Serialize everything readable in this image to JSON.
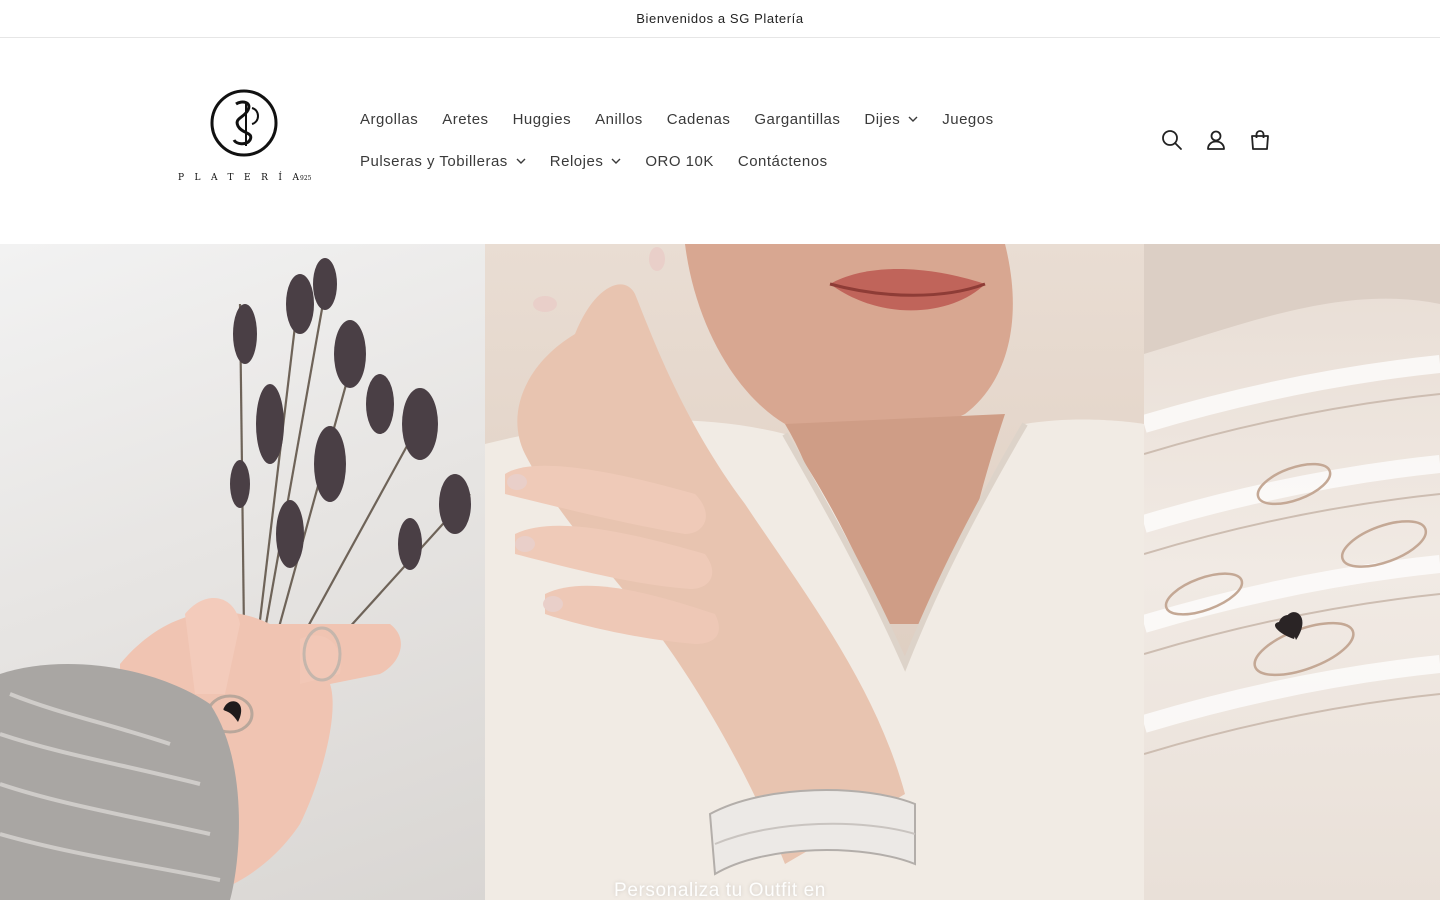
{
  "announcement": {
    "text": "Bienvenidos a SG Platería"
  },
  "logo": {
    "monogram": "SG",
    "wordmark": "PLATERÍA",
    "mark": "925"
  },
  "nav": {
    "row1": [
      {
        "label": "Argollas",
        "dropdown": false
      },
      {
        "label": "Aretes",
        "dropdown": false
      },
      {
        "label": "Huggies",
        "dropdown": false
      },
      {
        "label": "Anillos",
        "dropdown": false
      },
      {
        "label": "Cadenas",
        "dropdown": false
      },
      {
        "label": "Gargantillas",
        "dropdown": false
      },
      {
        "label": "Dijes",
        "dropdown": true
      },
      {
        "label": "Juegos",
        "dropdown": false
      }
    ],
    "row2": [
      {
        "label": "Pulseras y Tobilleras",
        "dropdown": true
      },
      {
        "label": "Relojes",
        "dropdown": true
      },
      {
        "label": "ORO 10K",
        "dropdown": false
      },
      {
        "label": "Contáctenos",
        "dropdown": false
      }
    ]
  },
  "header_icons": [
    "search-icon",
    "account-icon",
    "cart-icon"
  ],
  "hero": {
    "caption": "Personaliza tu Outfit en"
  },
  "colors": {
    "text": "#121212",
    "nav_text": "#3a3a3a",
    "border": "#e6e6e6"
  }
}
